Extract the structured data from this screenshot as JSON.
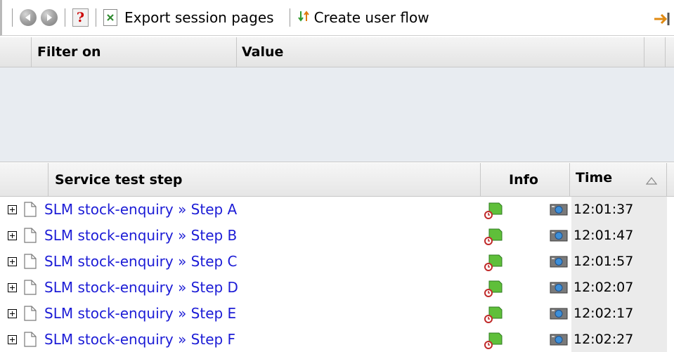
{
  "toolbar": {
    "back_icon": "back-arrow-icon",
    "forward_icon": "forward-arrow-icon",
    "help_icon": "help-icon",
    "export_label": "Export session pages",
    "export_icon": "excel-document-icon",
    "flow_label": "Create user flow",
    "flow_icon": "up-down-arrows-icon",
    "exit_icon": "exit-arrow-icon"
  },
  "filter_table": {
    "headers": [
      "Filter on",
      "Value"
    ]
  },
  "steps_table": {
    "headers": {
      "step": "Service test step",
      "info": "Info",
      "time": "Time"
    },
    "sort_icon": "sort-ascending-icon",
    "rows": [
      {
        "step": "SLM stock-enquiry » Step A",
        "time": "12:01:37"
      },
      {
        "step": "SLM stock-enquiry » Step B",
        "time": "12:01:47"
      },
      {
        "step": "SLM stock-enquiry » Step C",
        "time": "12:01:57"
      },
      {
        "step": "SLM stock-enquiry » Step D",
        "time": "12:02:07"
      },
      {
        "step": "SLM stock-enquiry » Step E",
        "time": "12:02:17"
      },
      {
        "step": "SLM stock-enquiry » Step F",
        "time": "12:02:27"
      }
    ]
  },
  "colors": {
    "link": "#1c1cd6",
    "filter_background": "#e8ecf1",
    "time_column_background": "#ebebeb"
  }
}
